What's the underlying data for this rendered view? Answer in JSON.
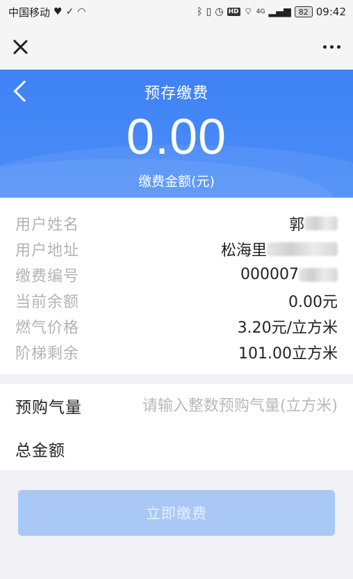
{
  "status_bar": {
    "carrier": "中国移动",
    "network": "4G",
    "battery": "82",
    "time": "09:42"
  },
  "header": {
    "title": "预存缴费",
    "amount": "0.00",
    "amount_label": "缴费金额(元)"
  },
  "info": {
    "rows": [
      {
        "label": "用户姓名",
        "value": "郭"
      },
      {
        "label": "用户地址",
        "value": "松海里"
      },
      {
        "label": "缴费编号",
        "value": "000007"
      },
      {
        "label": "当前余额",
        "value": "0.00元"
      },
      {
        "label": "燃气价格",
        "value": "3.20元/立方米"
      },
      {
        "label": "阶梯剩余",
        "value": "101.00立方米"
      }
    ]
  },
  "form": {
    "quantity_label": "预购气量",
    "quantity_placeholder": "请输入整数预购气量(立方米)",
    "quantity_value": "",
    "total_label": "总金额",
    "total_value": ""
  },
  "pay_button": {
    "label": "立即缴费",
    "enabled": false
  },
  "colors": {
    "header_blue": "#4b8df7",
    "button_disabled": "#a9c8f6"
  }
}
